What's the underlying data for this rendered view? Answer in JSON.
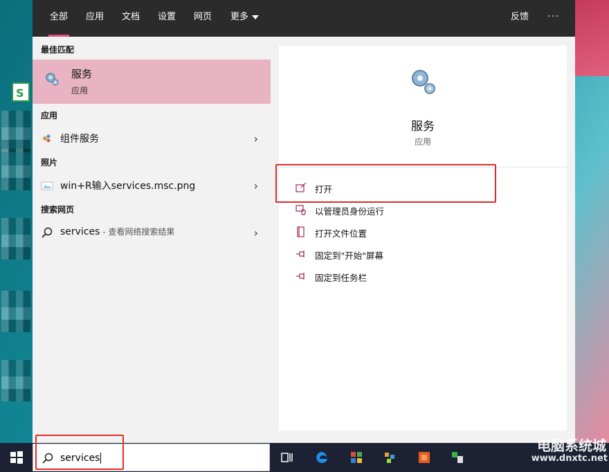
{
  "tabs": [
    {
      "label": "全部"
    },
    {
      "label": "应用"
    },
    {
      "label": "文档"
    },
    {
      "label": "设置"
    },
    {
      "label": "网页"
    },
    {
      "label": "更多"
    }
  ],
  "top_right": {
    "feedback": "反馈",
    "more": "···"
  },
  "sections": {
    "best_match": "最佳匹配",
    "apps": "应用",
    "photos": "照片",
    "web": "搜索网页"
  },
  "best_match": {
    "title": "服务",
    "subtitle": "应用"
  },
  "results": {
    "app_item": "组件服务",
    "photo_item": "win+R输入services.msc.png",
    "web_item": "services",
    "web_hint": " - 查看网络搜索结果"
  },
  "detail": {
    "title": "服务",
    "subtitle": "应用",
    "actions": [
      {
        "label": "打开",
        "icon": "open-icon"
      },
      {
        "label": "以管理员身份运行",
        "icon": "shield-icon"
      },
      {
        "label": "打开文件位置",
        "icon": "folder-icon"
      },
      {
        "label": "固定到\"开始\"屏幕",
        "icon": "pin-icon"
      },
      {
        "label": "固定到任务栏",
        "icon": "pin-icon"
      }
    ]
  },
  "search": {
    "value": "services"
  },
  "watermark": {
    "line1": "电脑系统城",
    "line2": "www.dnxtc.net"
  },
  "colors": {
    "accent": "#e64c7a",
    "highlight": "#e8b4c3",
    "annotation": "#e02b2b"
  }
}
